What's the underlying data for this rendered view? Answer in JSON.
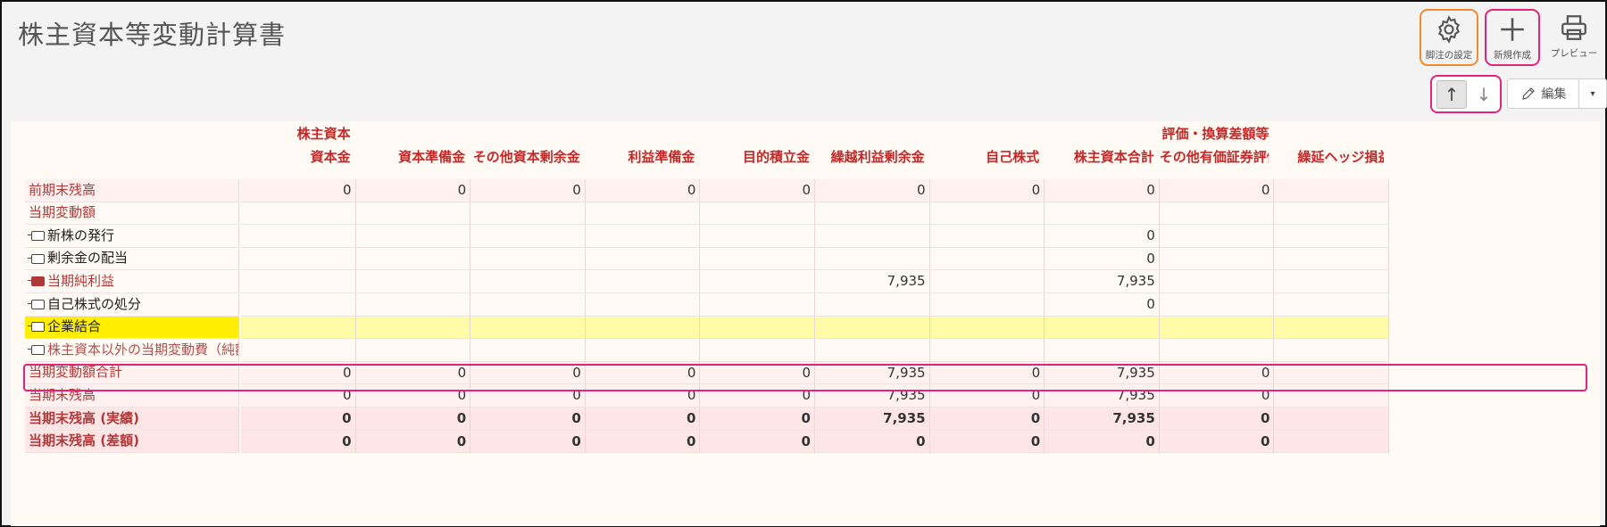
{
  "page": {
    "title": "株主資本等変動計算書"
  },
  "toolbar": {
    "footnote_label": "脚注の設定",
    "new_label": "新規作成",
    "preview_label": "プレビュー",
    "sort_up": "↑",
    "sort_down": "↓",
    "edit_label": "編集",
    "edit_caret": "▾"
  },
  "table": {
    "group_headers": [
      "株主資本",
      "評価・換算差額等"
    ],
    "columns": [
      "資本金",
      "資本準備金",
      "その他資本剰余金",
      "利益準備金",
      "目的積立金",
      "繰越利益剰余金",
      "自己株式",
      "株主資本合計",
      "その他有価証券評価",
      "繰延ヘッジ損益"
    ],
    "rows": [
      {
        "label": "前期末残高",
        "style": "summary",
        "icon": "",
        "values": [
          "0",
          "0",
          "0",
          "0",
          "0",
          "0",
          "0",
          "0",
          "0",
          ""
        ]
      },
      {
        "label": "当期変動額",
        "style": "section",
        "icon": "",
        "values": [
          "",
          "",
          "",
          "",
          "",
          "",
          "",
          "",
          "",
          ""
        ]
      },
      {
        "label": "新株の発行",
        "style": "item",
        "icon": "row-tag",
        "values": [
          "",
          "",
          "",
          "",
          "",
          "",
          "",
          "0",
          "",
          ""
        ]
      },
      {
        "label": "剰余金の配当",
        "style": "item",
        "icon": "row-tag",
        "values": [
          "",
          "",
          "",
          "",
          "",
          "",
          "",
          "0",
          "",
          ""
        ]
      },
      {
        "label": "当期純利益",
        "style": "item-red",
        "icon": "row-tag-filled",
        "values": [
          "",
          "",
          "",
          "",
          "",
          "7,935",
          "",
          "7,935",
          "",
          ""
        ]
      },
      {
        "label": "自己株式の処分",
        "style": "item",
        "icon": "row-tag",
        "values": [
          "",
          "",
          "",
          "",
          "",
          "",
          "",
          "0",
          "",
          ""
        ]
      },
      {
        "label": "企業結合",
        "style": "selected",
        "icon": "row-tag",
        "values": [
          "",
          "",
          "",
          "",
          "",
          "",
          "",
          "",
          "",
          ""
        ]
      },
      {
        "label": "株主資本以外の当期変動費（純額）",
        "style": "item-muted",
        "icon": "row-tag",
        "values": [
          "",
          "",
          "",
          "",
          "",
          "",
          "",
          "",
          "",
          ""
        ]
      },
      {
        "label": "当期変動額合計",
        "style": "summary",
        "icon": "",
        "values": [
          "0",
          "0",
          "0",
          "0",
          "0",
          "7,935",
          "0",
          "7,935",
          "0",
          ""
        ]
      },
      {
        "label": "当期末残高",
        "style": "summary",
        "icon": "",
        "values": [
          "0",
          "0",
          "0",
          "0",
          "0",
          "7,935",
          "0",
          "7,935",
          "0",
          ""
        ]
      },
      {
        "label": "当期末残高 (実績)",
        "style": "total",
        "icon": "",
        "values": [
          "0",
          "0",
          "0",
          "0",
          "0",
          "7,935",
          "0",
          "7,935",
          "0",
          ""
        ]
      },
      {
        "label": "当期末残高 (差額)",
        "style": "total",
        "icon": "",
        "values": [
          "0",
          "0",
          "0",
          "0",
          "0",
          "0",
          "0",
          "0",
          "0",
          ""
        ]
      }
    ]
  },
  "colors": {
    "accent_red": "#c62828",
    "highlight_pink": "#e2247a",
    "highlight_orange": "#f28a2e",
    "selected_row_bg": "#fffca8",
    "selected_label_bg": "#ffee00"
  }
}
